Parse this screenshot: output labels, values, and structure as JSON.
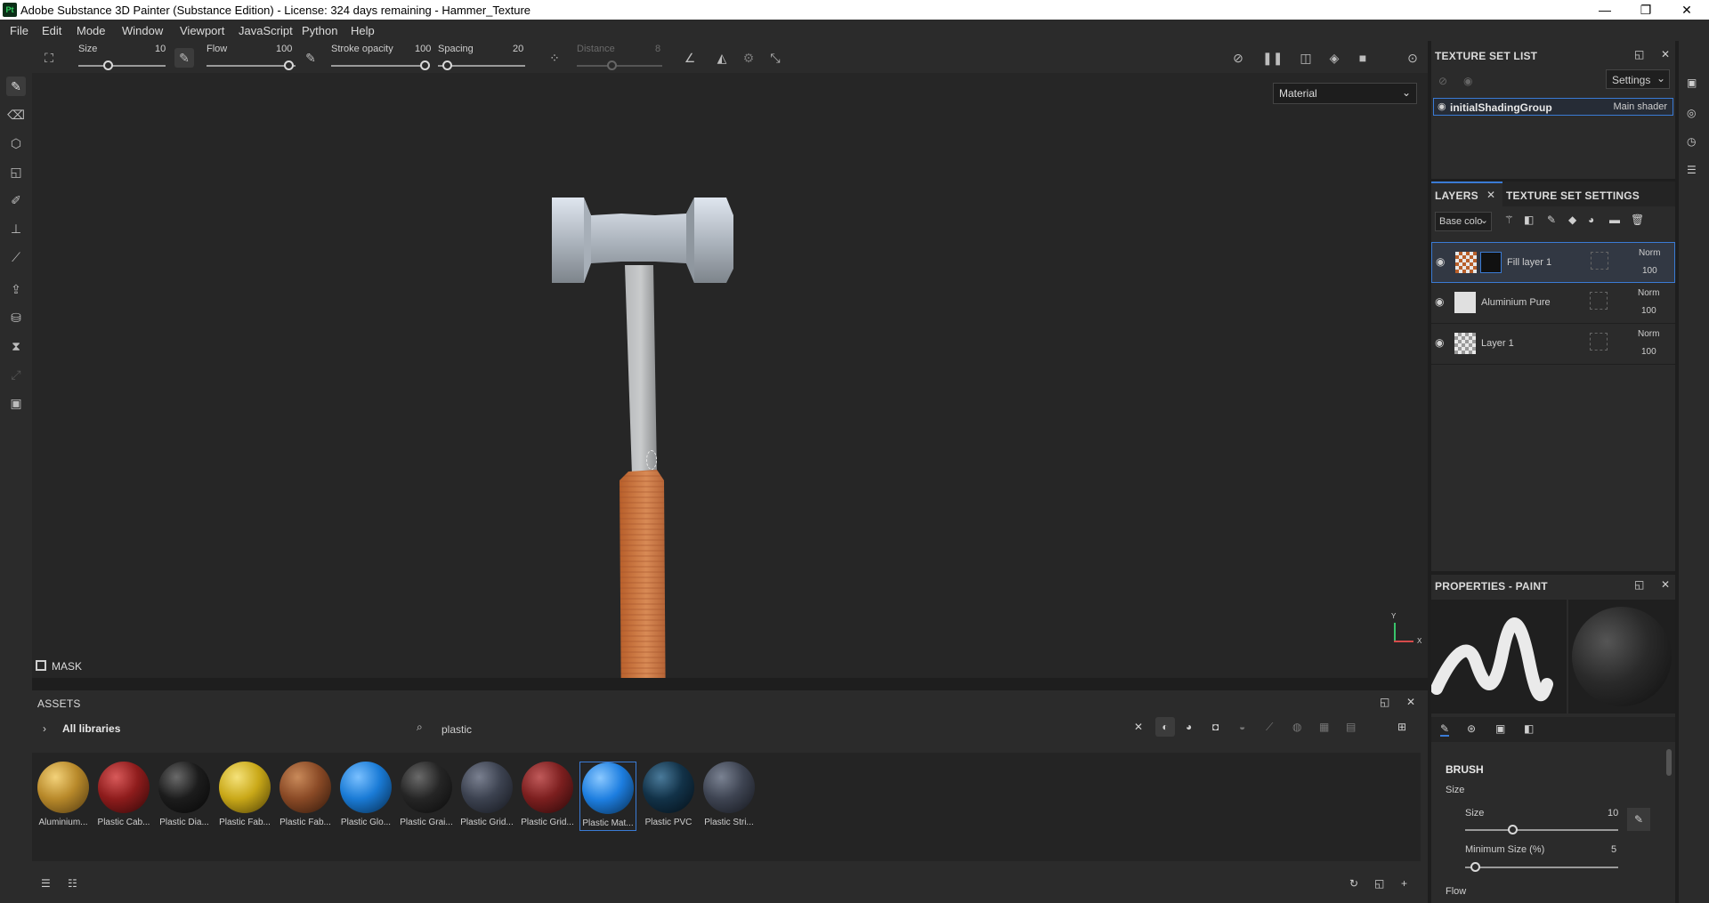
{
  "window": {
    "logo": "Pt",
    "title": "Adobe Substance 3D Painter (Substance Edition) - License: 324 days remaining - Hammer_Texture",
    "min": "—",
    "max": "❐",
    "close": "✕"
  },
  "menu": {
    "items": [
      "File",
      "Edit",
      "Mode",
      "Window",
      "Viewport",
      "JavaScript",
      "Python",
      "Help"
    ]
  },
  "tool_options": {
    "size_label": "Size",
    "size_value": "10",
    "flow_label": "Flow",
    "flow_value": "100",
    "stroke_label": "Stroke opacity",
    "stroke_value": "100",
    "spacing_label": "Spacing",
    "spacing_value": "20",
    "distance_label": "Distance",
    "distance_value": "8"
  },
  "viewport": {
    "render_mode": "Material",
    "mask_label": "MASK",
    "axis_y": "Y",
    "axis_x": "X"
  },
  "texture_set_list": {
    "title": "TEXTURE SET LIST",
    "settings_label": "Settings",
    "item_name": "initialShadingGroup",
    "item_shader": "Main shader"
  },
  "layers": {
    "tab_layers": "LAYERS",
    "tab_tss": "TEXTURE SET SETTINGS",
    "channel": "Base colo",
    "rows": [
      {
        "name": "Fill layer 1",
        "blend": "Norm",
        "opacity": "100"
      },
      {
        "name": "Aluminium Pure",
        "blend": "Norm",
        "opacity": "100"
      },
      {
        "name": "Layer 1",
        "blend": "Norm",
        "opacity": "100"
      }
    ]
  },
  "properties": {
    "title": "PROPERTIES - PAINT",
    "brush_section": "BRUSH",
    "size_group": "Size",
    "size_label": "Size",
    "size_value": "10",
    "minsize_label": "Minimum Size (%)",
    "minsize_value": "5",
    "flow_label": "Flow"
  },
  "assets": {
    "title": "ASSETS",
    "libraries": "All libraries",
    "search_value": "plastic",
    "items": [
      {
        "label": "Aluminium...",
        "color": "#b8892a"
      },
      {
        "label": "Plastic Cab...",
        "color": "#8e1c1c"
      },
      {
        "label": "Plastic Dia...",
        "color": "#1c1c1c"
      },
      {
        "label": "Plastic Fab...",
        "color": "#c9a818"
      },
      {
        "label": "Plastic Fab...",
        "color": "#8a4a26"
      },
      {
        "label": "Plastic Glo...",
        "color": "#1a7bd6"
      },
      {
        "label": "Plastic Grai...",
        "color": "#252525"
      },
      {
        "label": "Plastic Grid...",
        "color": "#3c4250"
      },
      {
        "label": "Plastic Grid...",
        "color": "#7c1f1f"
      },
      {
        "label": "Plastic Mat...",
        "color": "#1d7ee0"
      },
      {
        "label": "Plastic PVC",
        "color": "#123248"
      },
      {
        "label": "Plastic Stri...",
        "color": "#3e4452"
      }
    ]
  }
}
